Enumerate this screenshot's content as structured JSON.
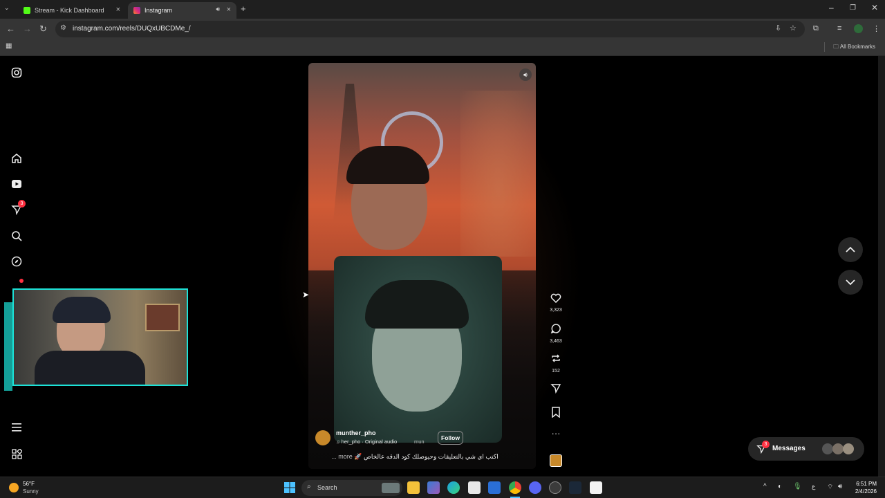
{
  "tabs": [
    {
      "title": "Stream - Kick Dashboard",
      "favicon_color": "#53fc18"
    },
    {
      "title": "Instagram",
      "favicon_color": "#e1306c"
    }
  ],
  "toolbar": {
    "url": "instagram.com/reels/DUQxUBCDMe_/",
    "bookmarks_label": "All Bookmarks"
  },
  "sidebar": {
    "items": [
      {
        "icon": "instagram-logo-icon"
      },
      {
        "icon": "home-icon"
      },
      {
        "icon": "reels-icon"
      },
      {
        "icon": "messages-icon",
        "badge": "3"
      },
      {
        "icon": "search-icon"
      },
      {
        "icon": "explore-icon"
      },
      {
        "icon": "notifications-icon"
      },
      {
        "icon": "menu-icon"
      },
      {
        "icon": "also-from-meta-icon"
      }
    ]
  },
  "reel": {
    "username": "munther_pho",
    "audio": "her_pho · Original audio",
    "audio_trailing": "mun",
    "follow_label": "Follow",
    "caption": "اكتب اي شي بالتعليقات وحيوصلك كود الدقه عالخاص 🚀",
    "more_label": "more ...",
    "likes": "3,323",
    "comments": "3,463",
    "reposts": "152"
  },
  "messages": {
    "label": "Messages",
    "badge": "3"
  },
  "taskbar": {
    "weather_temp": "56°F",
    "weather_desc": "Sunny",
    "search_label": "Search",
    "time": "6:51 PM",
    "date": "2/4/2026",
    "lang": "ع"
  },
  "colors": {
    "accent_cam_border": "#1de2d8",
    "badge_red": "#ff3040"
  }
}
